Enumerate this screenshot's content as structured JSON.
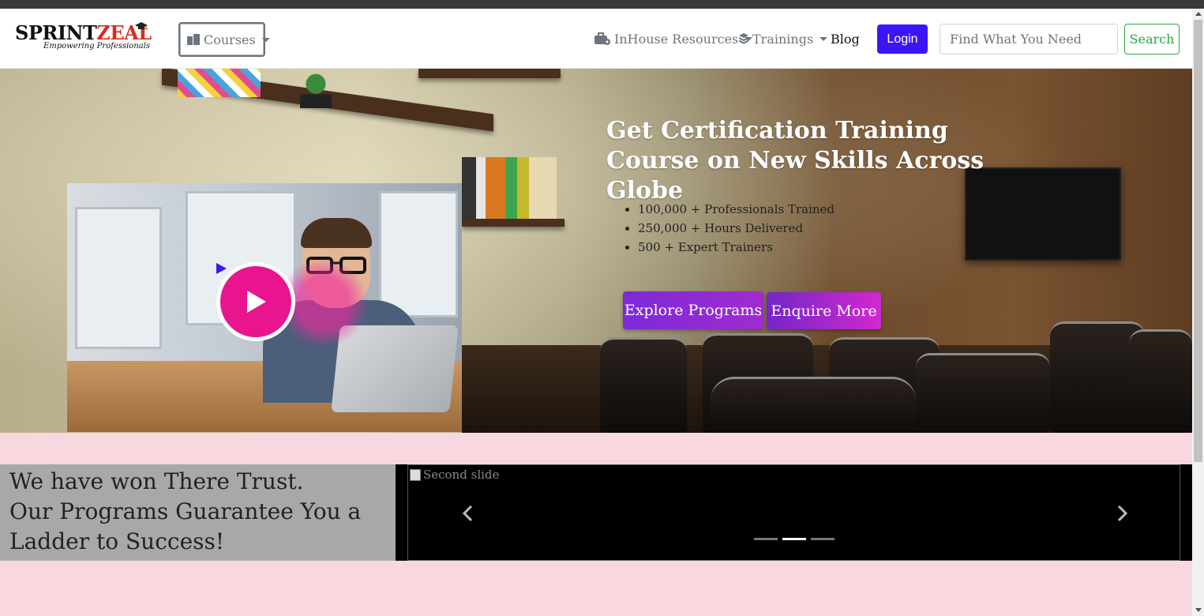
{
  "brand": {
    "name_part1": "SPRINT",
    "name_part2": "ZEAL",
    "tagline": "Empowering Professionals"
  },
  "nav": {
    "courses_label": "Courses",
    "inhouse_label": "InHouse Resources",
    "trainings_label": "Trainings",
    "blog_label": "Blog",
    "login_label": "Login",
    "search_placeholder": "Find What You Need",
    "search_button": "Search"
  },
  "hero": {
    "title": "Get Certification Training Course on New Skills Across Globe",
    "stats": [
      "100,000 + Professionals Trained",
      "250,000 + Hours Delivered",
      "500 + Expert Trainers"
    ],
    "explore_button": "Explore Programs",
    "enquire_button": "Enquire More"
  },
  "trust": {
    "line1": "We have won There Trust.",
    "line2": "Our Programs Guarantee You a Ladder to Success!"
  },
  "carousel": {
    "image_alt": "Second slide",
    "indicator_count": 3,
    "active_index": 1
  },
  "colors": {
    "login_bg": "#3d14f5",
    "search_btn": "#28a745",
    "play_pink": "#e8158f",
    "page_bg": "#f8d7de",
    "trust_bg": "#a8a8a8"
  },
  "icons": [
    "book-icon",
    "toolbox-icon",
    "layers-icon",
    "play-icon",
    "chevron-left-icon",
    "chevron-right-icon",
    "graduation-cap-icon",
    "broken-image-icon"
  ]
}
